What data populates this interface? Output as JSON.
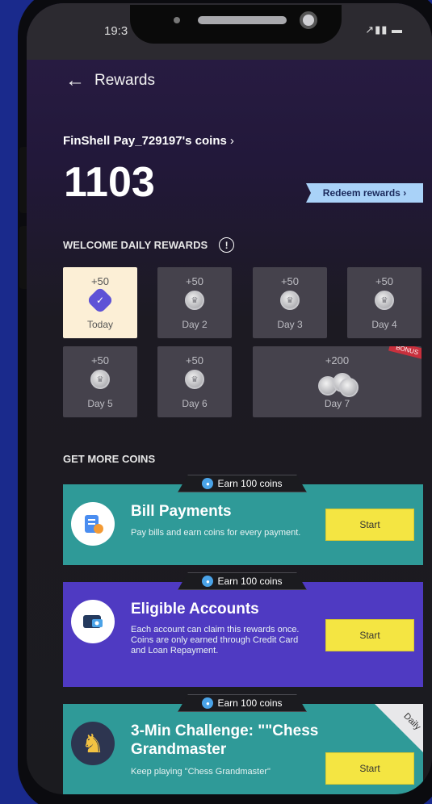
{
  "status": {
    "time": "19:3"
  },
  "header": {
    "back_label": "←",
    "title": "Rewards"
  },
  "account": {
    "owner_label": "FinShell Pay_729197's coins",
    "coins": "1103",
    "redeem_label": "Redeem rewards"
  },
  "welcome": {
    "title": "WELCOME DAILY REWARDS",
    "days": [
      {
        "amount": "+50",
        "label": "Today"
      },
      {
        "amount": "+50",
        "label": "Day 2"
      },
      {
        "amount": "+50",
        "label": "Day 3"
      },
      {
        "amount": "+50",
        "label": "Day 4"
      },
      {
        "amount": "+50",
        "label": "Day 5"
      },
      {
        "amount": "+50",
        "label": "Day 6"
      },
      {
        "amount": "+200",
        "label": "Day 7",
        "badge": "BONUS"
      }
    ]
  },
  "more": {
    "title": "GET MORE COINS",
    "tasks": [
      {
        "tag": "Earn 100 coins",
        "title": "Bill Payments",
        "desc": "Pay bills and earn coins for every payment.",
        "button": "Start",
        "color": "#2f9a98"
      },
      {
        "tag": "Earn 100 coins",
        "title": "Eligible Accounts",
        "desc": "Each account can claim this rewards once. Coins are only earned through Credit Card and Loan Repayment.",
        "button": "Start",
        "color": "#4f3ac2"
      },
      {
        "tag": "Earn 100 coins",
        "title": "3-Min Challenge: \"\"Chess Grandmaster",
        "desc": "Keep playing \"Chess Grandmaster\"",
        "button": "Start",
        "color": "#2f9a98",
        "corner": "Daily"
      }
    ]
  },
  "colors": {
    "background": "#1a2a8c",
    "accent_yellow": "#f4e542",
    "redeem": "#a9d2f8"
  }
}
